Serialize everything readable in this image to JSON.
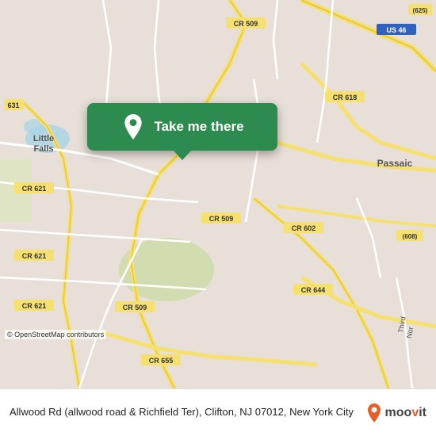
{
  "map": {
    "background_color": "#e8e0d8",
    "center_lat": 40.855,
    "center_lng": -74.155
  },
  "popup": {
    "label": "Take me there",
    "background_color": "#2e8b4f",
    "pin_color": "#ffffff"
  },
  "info_bar": {
    "address_line1": "Allwood Rd (allwood road & Richfield Ter), Clifton, NJ",
    "address_line2": "07012, New York City",
    "full_text": "Allwood Rd (allwood road & Richfield Ter), Clifton, NJ 07012, New York City"
  },
  "attribution": {
    "text": "© OpenStreetMap contributors"
  },
  "logo": {
    "name": "moovit",
    "text_plain": "moovit",
    "text_colored": "moovit"
  },
  "road_labels": [
    {
      "id": "cr509_top",
      "text": "CR 509"
    },
    {
      "id": "us46",
      "text": "US 46"
    },
    {
      "id": "cr625",
      "text": "(625)"
    },
    {
      "id": "cr631",
      "text": "631"
    },
    {
      "id": "cr621_mid",
      "text": "CR 621"
    },
    {
      "id": "cr618",
      "text": "CR 618"
    },
    {
      "id": "cr621_bot1",
      "text": "CR 621"
    },
    {
      "id": "cr621_bot2",
      "text": "CR 621"
    },
    {
      "id": "cr509_mid",
      "text": "CR 509"
    },
    {
      "id": "cr602",
      "text": "CR 602"
    },
    {
      "id": "cr608",
      "text": "(608)"
    },
    {
      "id": "cr509_bot",
      "text": "CR 509"
    },
    {
      "id": "cr644",
      "text": "CR 644"
    },
    {
      "id": "cr655",
      "text": "CR 655"
    },
    {
      "id": "little_falls",
      "text": "Little Falls"
    },
    {
      "id": "passaic",
      "text": "Passaic"
    }
  ]
}
